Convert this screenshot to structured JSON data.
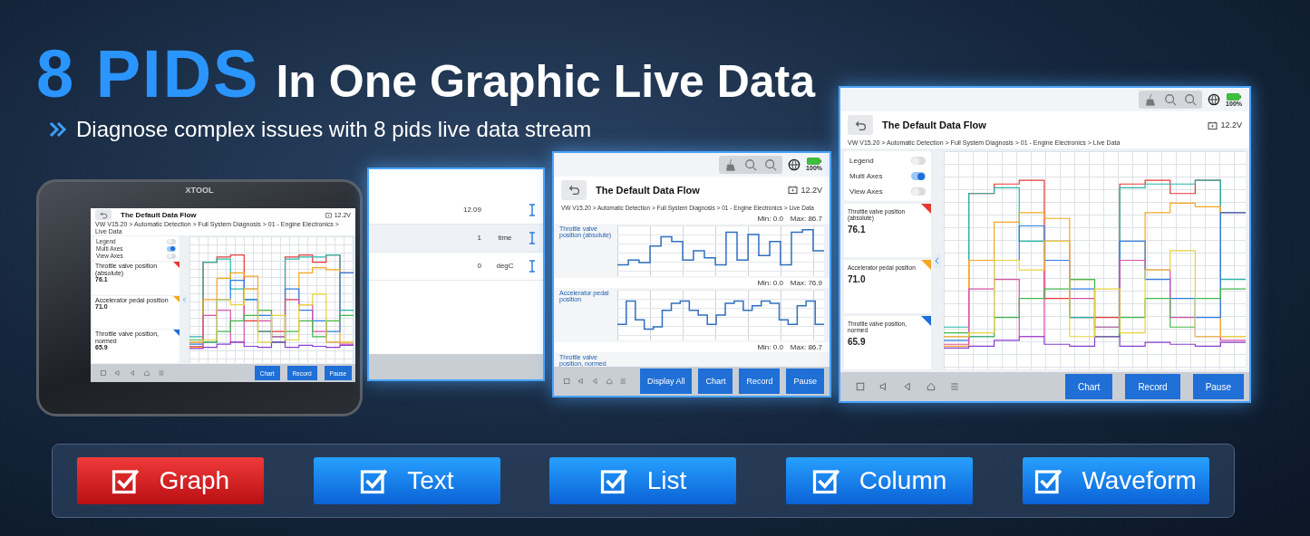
{
  "headline": {
    "highlight": "8 PIDS",
    "text": "In One Graphic Live Data"
  },
  "subtitle": "Diagnose complex issues with 8 pids live data stream",
  "device": {
    "brand": "XTOOL",
    "screen": {
      "kind": "graph",
      "title": "The Default Data Flow",
      "voltage": "12.2V",
      "breadcrumb": "VW V15.20 > Automatic Detection > Full System Diagnosis > 01 - Engine Electronics > Live Data",
      "toggles": [
        {
          "label": "Legend",
          "on": false
        },
        {
          "label": "Multi Axes",
          "on": true
        },
        {
          "label": "View Axes",
          "on": false
        }
      ],
      "pids": [
        {
          "label": "Throttle valve position (absolute)",
          "value": "76.1",
          "color": "#e53935"
        },
        {
          "label": "Accelerator pedal position",
          "value": "71.0",
          "color": "#f5a623"
        },
        {
          "label": "Throttle valve position, normed",
          "value": "65.9",
          "color": "#1e6fd9"
        }
      ],
      "buttons": [
        "Chart",
        "Record",
        "Pause"
      ]
    }
  },
  "screens": [
    {
      "kind": "table",
      "rows": [
        {
          "value": "12.09"
        },
        {
          "value": "1",
          "unit": "time"
        },
        {
          "value": "0",
          "unit": "degC"
        }
      ]
    },
    {
      "kind": "column",
      "battery": "100%",
      "title": "The Default Data Flow",
      "voltage": "12.2V",
      "breadcrumb": "VW V15.20 > Automatic Detection > Full System Diagnosis > 01 - Engine Electronics > Live Data",
      "panels": [
        {
          "label": "Throttle valve position (absolute)",
          "min": "Min: 0.0",
          "max": "Max: 86.7"
        },
        {
          "label": "Accelerator pedal position",
          "min": "Min: 0.0",
          "max": "Max: 76.9"
        },
        {
          "label": "Throttle valve position, normed",
          "min": "Min: 0.0",
          "max": "Max: 86.7"
        }
      ],
      "buttons": [
        "Display All",
        "Chart",
        "Record",
        "Pause"
      ]
    },
    {
      "kind": "graph",
      "battery": "100%",
      "title": "The Default Data Flow",
      "voltage": "12.2V",
      "breadcrumb": "VW V15.20 > Automatic Detection > Full System Diagnosis > 01 - Engine Electronics > Live Data",
      "toggles": [
        {
          "label": "Legend",
          "on": false
        },
        {
          "label": "Multi Axes",
          "on": true
        },
        {
          "label": "View Axes",
          "on": false
        }
      ],
      "pids": [
        {
          "label": "Throttle valve position (absolute)",
          "value": "76.1",
          "color": "#e53935"
        },
        {
          "label": "Accelerator pedal position",
          "value": "71.0",
          "color": "#f5a623"
        },
        {
          "label": "Throttle valve position, normed",
          "value": "65.9",
          "color": "#1e6fd9"
        }
      ],
      "buttons": [
        "Chart",
        "Record",
        "Pause"
      ]
    }
  ],
  "modes": [
    {
      "label": "Graph",
      "checked": true,
      "selected": true
    },
    {
      "label": "Text",
      "checked": true,
      "selected": false
    },
    {
      "label": "List",
      "checked": true,
      "selected": false
    },
    {
      "label": "Column",
      "checked": true,
      "selected": false
    },
    {
      "label": "Waveform",
      "checked": true,
      "selected": false
    }
  ]
}
